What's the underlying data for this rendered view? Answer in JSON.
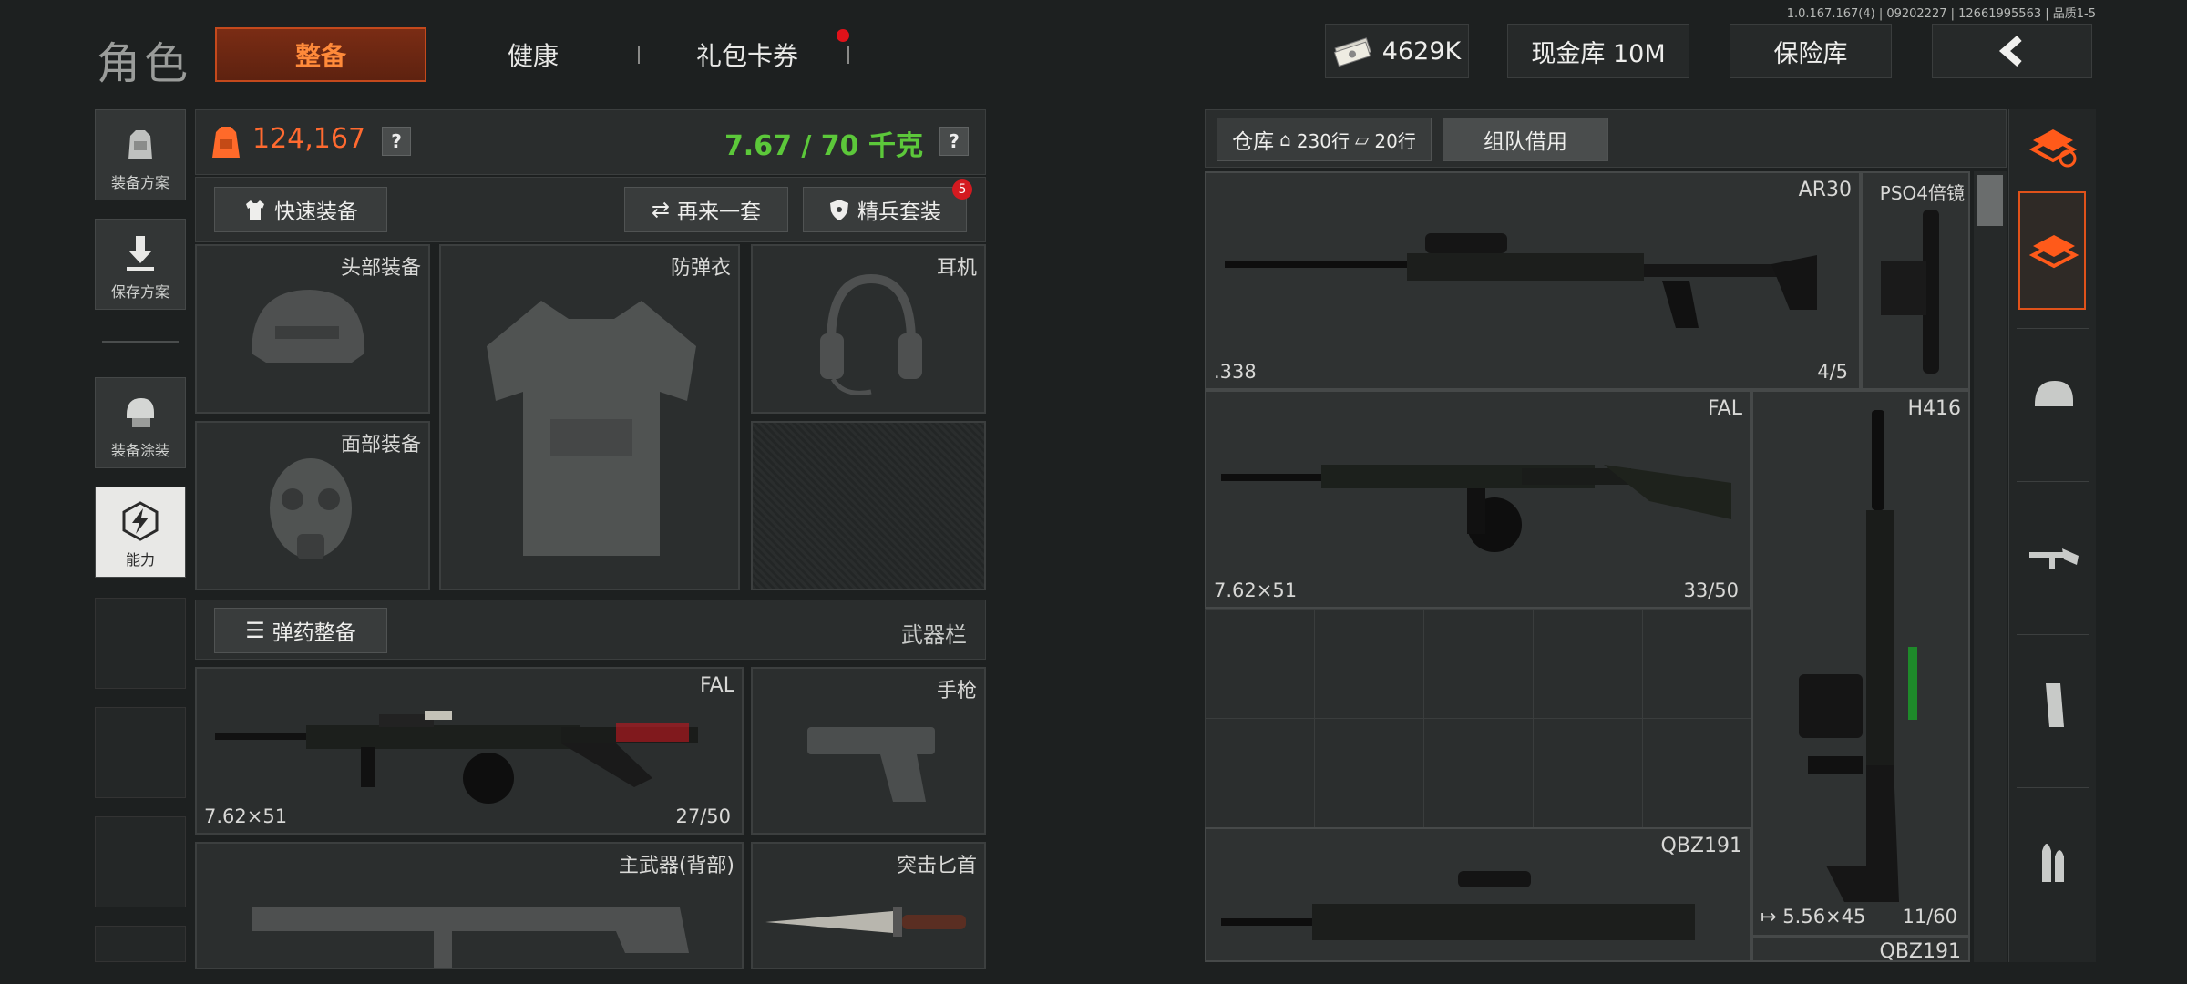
{
  "build_info": "1.0.167.167(4) | 09202227 | 12661995563 | 品质1-5",
  "header": {
    "title": "角色",
    "tabs": [
      {
        "label": "整备",
        "active": true
      },
      {
        "label": "健康",
        "active": false
      },
      {
        "label": "礼包卡券",
        "active": false,
        "notification": true
      }
    ],
    "currency_amount": "4629K",
    "cash_vault_label": "现金库 10M",
    "safe_label": "保险库",
    "back_icon": "chevron-left-icon"
  },
  "sidebar": {
    "items": [
      {
        "label": "装备方案",
        "icon": "backpack-icon"
      },
      {
        "label": "保存方案",
        "icon": "download-icon"
      },
      {
        "label": "装备涂装",
        "icon": "helmet-paint-icon"
      },
      {
        "label": "能力",
        "icon": "lightning-hex-icon",
        "active": true
      }
    ]
  },
  "loadout": {
    "value": "124,167",
    "weight": "7.67 / 70 千克",
    "help_icon": "?",
    "quick_equip_label": "快速装备",
    "again_label": "再来一套",
    "elite_label": "精兵套装",
    "elite_badge": "5",
    "slots": {
      "head": "头部装备",
      "armor": "防弹衣",
      "headset": "耳机",
      "face": "面部装备"
    },
    "ammo_label": "弹药整备",
    "weapon_bar_label": "武器栏",
    "primary": {
      "name": "FAL",
      "caliber": "7.62×51",
      "ammo": "27/50"
    },
    "pistol_label": "手枪",
    "back_weapon_label": "主武器(背部)",
    "knife_label": "突击匕首"
  },
  "storage": {
    "warehouse_label": "仓库",
    "warehouse_rows": "230行",
    "second_rows": "20行",
    "team_borrow_label": "组队借用",
    "items": [
      {
        "name": "AR30",
        "caliber": ".338",
        "ammo": "4/5"
      },
      {
        "name": "PSO4倍镜"
      },
      {
        "name": "FAL",
        "caliber": "7.62×51",
        "ammo": "33/50"
      },
      {
        "name": "H416",
        "caliber": "5.56×45",
        "ammo": "11/60"
      },
      {
        "name": "QBZ191"
      },
      {
        "name": "QBZ191"
      }
    ]
  },
  "colors": {
    "accent": "#ff6a2a",
    "value_orange": "#ff6a30",
    "weight_green": "#5cc83a",
    "tab_active_bg": "#6b2612"
  }
}
